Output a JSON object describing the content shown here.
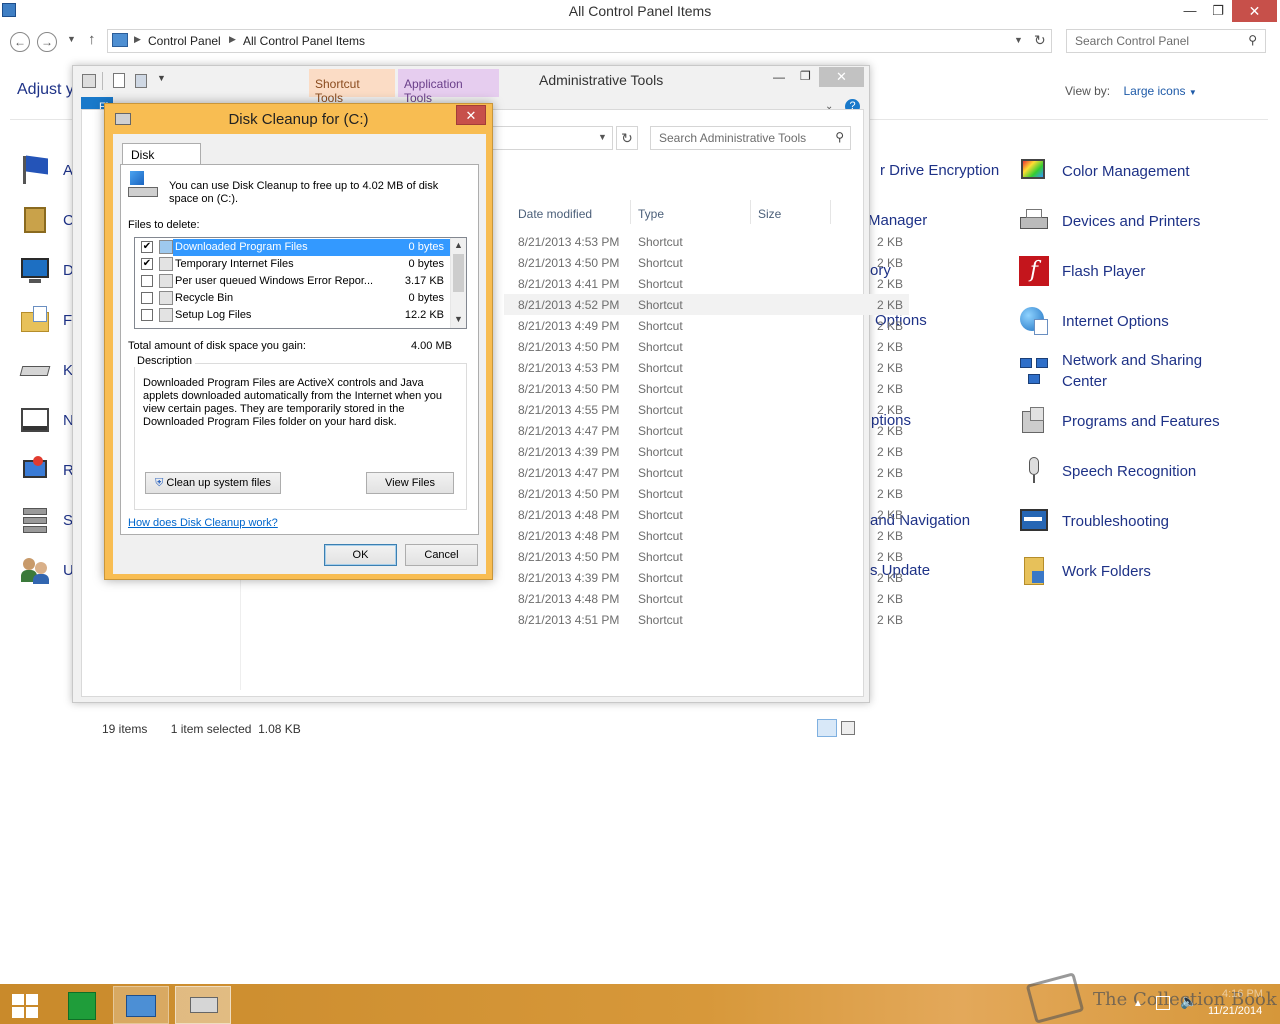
{
  "control_panel": {
    "window_title": "All Control Panel Items",
    "breadcrumb": [
      "Control Panel",
      "All Control Panel Items"
    ],
    "search_placeholder": "Search Control Panel",
    "heading_partial": "Adjust y",
    "view_by_label": "View by:",
    "view_by_value": "Large icons",
    "left_partial_labels": [
      "A",
      "C",
      "D",
      "F",
      "K",
      "N",
      "R",
      "S",
      "U"
    ],
    "middle_partial_labels": [
      "r Drive Encryption",
      "Manager",
      "ory",
      "Options",
      "ptions",
      "and Navigation",
      "s Update"
    ],
    "right_items": [
      "Color Management",
      "Devices and Printers",
      "Flash Player",
      "Internet Options",
      "Network and Sharing Center",
      "Programs and Features",
      "Speech Recognition",
      "Troubleshooting",
      "Work Folders"
    ]
  },
  "admin_tools": {
    "window_title": "Administrative Tools",
    "ctx_tab_shortcut": "Shortcut Tools",
    "ctx_tab_application": "Application Tools",
    "file_tab_partial": "Fi",
    "search_placeholder": "Search Administrative Tools",
    "columns": {
      "date": "Date modified",
      "type": "Type",
      "size": "Size"
    },
    "rows": [
      {
        "date": "8/21/2013 4:53 PM",
        "type": "Shortcut",
        "size": "2 KB"
      },
      {
        "date": "8/21/2013 4:50 PM",
        "type": "Shortcut",
        "size": "2 KB"
      },
      {
        "date": "8/21/2013 4:41 PM",
        "type": "Shortcut",
        "size": "2 KB"
      },
      {
        "date": "8/21/2013 4:52 PM",
        "type": "Shortcut",
        "size": "2 KB"
      },
      {
        "date": "8/21/2013 4:49 PM",
        "type": "Shortcut",
        "size": "2 KB"
      },
      {
        "date": "8/21/2013 4:50 PM",
        "type": "Shortcut",
        "size": "2 KB"
      },
      {
        "date": "8/21/2013 4:53 PM",
        "type": "Shortcut",
        "size": "2 KB"
      },
      {
        "date": "8/21/2013 4:50 PM",
        "type": "Shortcut",
        "size": "2 KB"
      },
      {
        "date": "8/21/2013 4:55 PM",
        "type": "Shortcut",
        "size": "2 KB"
      },
      {
        "date": "8/21/2013 4:47 PM",
        "type": "Shortcut",
        "size": "2 KB"
      },
      {
        "date": "8/21/2013 4:39 PM",
        "type": "Shortcut",
        "size": "2 KB"
      },
      {
        "date": "8/21/2013 4:47 PM",
        "type": "Shortcut",
        "size": "2 KB"
      },
      {
        "date": "8/21/2013 4:50 PM",
        "type": "Shortcut",
        "size": "2 KB"
      },
      {
        "date": "8/21/2013 4:48 PM",
        "type": "Shortcut",
        "size": "2 KB"
      },
      {
        "date": "8/21/2013 4:48 PM",
        "type": "Shortcut",
        "size": "2 KB"
      },
      {
        "date": "8/21/2013 4:50 PM",
        "type": "Shortcut",
        "size": "2 KB"
      },
      {
        "date": "8/21/2013 4:39 PM",
        "type": "Shortcut",
        "size": "2 KB"
      },
      {
        "date": "8/21/2013 4:48 PM",
        "type": "Shortcut",
        "size": "2 KB"
      },
      {
        "date": "8/21/2013 4:51 PM",
        "type": "Shortcut",
        "size": "2 KB"
      }
    ],
    "hovered_row_index": 3,
    "status_items": "19 items",
    "status_selected": "1 item selected  1.08 KB"
  },
  "disk_cleanup": {
    "title": "Disk Cleanup for  (C:)",
    "tab": "Disk Cleanup",
    "intro": "You can use Disk Cleanup to free up to 4.02 MB of disk space on  (C:).",
    "files_label": "Files to delete:",
    "files": [
      {
        "name": "Downloaded Program Files",
        "size": "0 bytes",
        "checked": true,
        "selected": true
      },
      {
        "name": "Temporary Internet Files",
        "size": "0 bytes",
        "checked": true,
        "selected": false
      },
      {
        "name": "Per user queued Windows Error Repor...",
        "size": "3.17 KB",
        "checked": false,
        "selected": false
      },
      {
        "name": "Recycle Bin",
        "size": "0 bytes",
        "checked": false,
        "selected": false
      },
      {
        "name": "Setup Log Files",
        "size": "12.2 KB",
        "checked": false,
        "selected": false
      }
    ],
    "total_label": "Total amount of disk space you gain:",
    "total_value": "4.00 MB",
    "description_label": "Description",
    "description_text": "Downloaded Program Files are ActiveX controls and Java applets downloaded automatically from the Internet when you view certain pages. They are temporarily stored in the Downloaded Program Files folder on your hard disk.",
    "cleanup_system_button": "Clean up system files",
    "view_files_button": "View Files",
    "help_link": "How does Disk Cleanup work?",
    "ok_button": "OK",
    "cancel_button": "Cancel"
  },
  "taskbar": {
    "watermark": "The Collection Book",
    "time_partial": "4:16 PM",
    "date": "11/21/2014"
  },
  "colors": {
    "link_blue": "#1e3287",
    "dialog_frame": "#f8bd52",
    "close_red": "#c7504a",
    "selection_blue": "#3399ff",
    "taskbar_orange": "#d7983a"
  }
}
